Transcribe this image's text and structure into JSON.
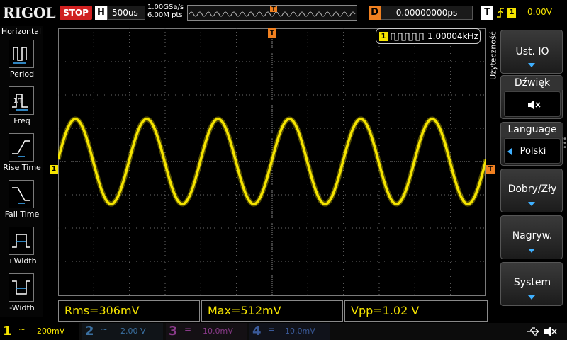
{
  "topbar": {
    "logo": "RIGOL",
    "run_state": "STOP",
    "timebase_key": "H",
    "timebase_value": "500us",
    "sample_rate": "1.00GSa/s",
    "memory_depth": "6.00M pts",
    "trigger_pos_marker": "T",
    "delay_key": "D",
    "delay_value": "0.00000000ps",
    "trigger_key": "T",
    "trigger_source": "1",
    "trigger_level": "0.00V"
  },
  "left_menu": {
    "title": "Horizontal",
    "items": [
      {
        "label": "Period",
        "icon": "period-icon"
      },
      {
        "label": "Freq",
        "icon": "freq-icon"
      },
      {
        "label": "Rise Time",
        "icon": "rise-time-icon"
      },
      {
        "label": "Fall Time",
        "icon": "fall-time-icon"
      },
      {
        "label": "+Width",
        "icon": "pos-width-icon"
      },
      {
        "label": "-Width",
        "icon": "neg-width-icon"
      }
    ]
  },
  "display": {
    "ch1_marker": "1",
    "trigger_marker": "T",
    "top_marker": "T",
    "frequency_counter": {
      "channel": "1",
      "value": "1.00004kHz"
    },
    "waveform": {
      "color": "#f5e400",
      "cycles_on_screen": 6,
      "amplitude_divisions": 2.56
    }
  },
  "measurements": [
    {
      "text": "Rms=306mV"
    },
    {
      "text": "Max=512mV"
    },
    {
      "text": "Vpp=1.02 V"
    }
  ],
  "right_menu": {
    "title": "Użyteczność",
    "items": [
      {
        "label": "Ust. IO",
        "type": "submenu"
      },
      {
        "label": "Dźwięk",
        "type": "value",
        "value_icon": "speaker-mute-icon",
        "value": "🔈×"
      },
      {
        "label": "Language",
        "type": "value",
        "value": "Polski"
      },
      {
        "label": "Dobry/Zły",
        "type": "submenu"
      },
      {
        "label": "Nagryw.",
        "type": "submenu"
      },
      {
        "label": "System",
        "type": "submenu"
      }
    ]
  },
  "bottombar": {
    "channels": [
      {
        "num": "1",
        "coupling": "~",
        "scale": "200mV",
        "color": "#f5e400",
        "active": true
      },
      {
        "num": "2",
        "coupling": "~",
        "scale": "2.00 V",
        "color": "#3a6fa0",
        "active": false
      },
      {
        "num": "3",
        "coupling": "=",
        "scale": "10.0mV",
        "color": "#8a3a8a",
        "active": false
      },
      {
        "num": "4",
        "coupling": "=",
        "scale": "10.0mV",
        "color": "#3a5a9a",
        "active": false
      }
    ]
  },
  "colors": {
    "ch1": "#f5e400",
    "trigger": "#f08020",
    "stop": "#d02020",
    "menu_arrow": "#3fb0ff"
  }
}
